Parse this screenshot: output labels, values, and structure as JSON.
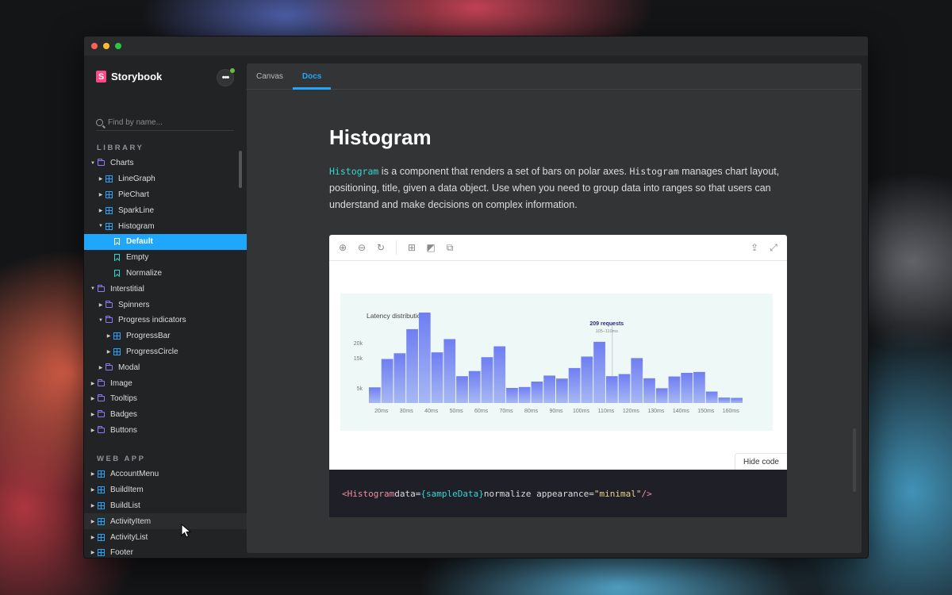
{
  "sidebar": {
    "brand": "Storybook",
    "menu_label": "•••",
    "search_placeholder": "Find by name...",
    "library_title": "LIBRARY",
    "webapp_title": "WEB APP",
    "library": [
      {
        "label": "Charts",
        "type": "folder",
        "depth": 0,
        "caret": "▼"
      },
      {
        "label": "LineGraph",
        "type": "component",
        "depth": 1,
        "caret": "▶"
      },
      {
        "label": "PieChart",
        "type": "component",
        "depth": 1,
        "caret": "▶"
      },
      {
        "label": "SparkLine",
        "type": "component",
        "depth": 1,
        "caret": "▶"
      },
      {
        "label": "Histogram",
        "type": "component",
        "depth": 1,
        "caret": "▼"
      },
      {
        "label": "Default",
        "type": "story",
        "depth": 2,
        "caret": "",
        "selected": true
      },
      {
        "label": "Empty",
        "type": "story",
        "depth": 2,
        "caret": ""
      },
      {
        "label": "Normalize",
        "type": "story",
        "depth": 2,
        "caret": ""
      },
      {
        "label": "Interstitial",
        "type": "folder",
        "depth": 0,
        "caret": "▼"
      },
      {
        "label": "Spinners",
        "type": "folder",
        "depth": 1,
        "caret": "▶"
      },
      {
        "label": "Progress indicators",
        "type": "folder",
        "depth": 1,
        "caret": "▼"
      },
      {
        "label": "ProgressBar",
        "type": "component",
        "depth": 2,
        "caret": "▶"
      },
      {
        "label": "ProgressCircle",
        "type": "component",
        "depth": 2,
        "caret": "▶"
      },
      {
        "label": "Modal",
        "type": "folder",
        "depth": 1,
        "caret": "▶"
      },
      {
        "label": "Image",
        "type": "folder",
        "depth": 0,
        "caret": "▶"
      },
      {
        "label": "Tooltips",
        "type": "folder",
        "depth": 0,
        "caret": "▶"
      },
      {
        "label": "Badges",
        "type": "folder",
        "depth": 0,
        "caret": "▶"
      },
      {
        "label": "Buttons",
        "type": "folder",
        "depth": 0,
        "caret": "▶"
      }
    ],
    "webapp": [
      {
        "label": "AccountMenu",
        "type": "component",
        "depth": 0,
        "caret": "▶"
      },
      {
        "label": "BuildItem",
        "type": "component",
        "depth": 0,
        "caret": "▶"
      },
      {
        "label": "BuildList",
        "type": "component",
        "depth": 0,
        "caret": "▶"
      },
      {
        "label": "ActivityItem",
        "type": "component",
        "depth": 0,
        "caret": "▶",
        "hover": true
      },
      {
        "label": "ActivityList",
        "type": "component",
        "depth": 0,
        "caret": "▶"
      },
      {
        "label": "Footer",
        "type": "component",
        "depth": 0,
        "caret": "▶"
      },
      {
        "label": "Header",
        "type": "component",
        "depth": 0,
        "caret": "▶"
      }
    ]
  },
  "tabs": [
    {
      "label": "Canvas",
      "active": false
    },
    {
      "label": "Docs",
      "active": true
    }
  ],
  "doc": {
    "title": "Histogram",
    "desc_code_1": "Histogram",
    "desc_text_1": " is a component that renders a set of bars on polar axes. ",
    "desc_code_2": "Histogram",
    "desc_text_2": " manages chart layout, positioning, title, given a data object. Use when you need to group data into ranges so that users can understand and make decisions on complex information."
  },
  "preview_toolbar": {
    "zoom_in": "⊕",
    "zoom_out": "⊖",
    "reset": "↻",
    "grid": "⊞",
    "background": "◩",
    "outline": "⧉",
    "share": "⇪",
    "fullscreen": "⤢"
  },
  "hide_code_label": "Hide code",
  "code": {
    "tag_open": "<Histogram",
    "attr1": " data=",
    "brace_value": "{sampleData}",
    "attr2": " normalize appearance=",
    "str_value": "\"minimal\"",
    "tag_close": " />"
  },
  "colors": {
    "accent": "#1ea7fd",
    "brand": "#ff4785",
    "bar_top": "#6f7ef2",
    "bar_bottom": "#a7b8f3"
  },
  "chart_data": {
    "type": "bar",
    "title": "Latency distribution",
    "xlabel": "",
    "ylabel": "",
    "ylim": [
      0,
      25000
    ],
    "yticks": [
      5000,
      15000,
      20000
    ],
    "ytick_labels": [
      "5k",
      "15k",
      "20k"
    ],
    "xtick_labels": [
      "20ms",
      "30ms",
      "40ms",
      "50ms",
      "60ms",
      "70ms",
      "80ms",
      "90ms",
      "100ms",
      "110ms",
      "120ms",
      "130ms",
      "140ms",
      "150ms",
      "160ms"
    ],
    "values": [
      5200,
      14600,
      16500,
      24500,
      30000,
      16800,
      21200,
      8900,
      10600,
      15200,
      18800,
      5000,
      5300,
      7100,
      9100,
      8100,
      11600,
      15400,
      20300,
      8900,
      9600,
      14900,
      8200,
      4900,
      8800,
      10000,
      10300,
      3800,
      1800,
      1700
    ],
    "annotation": {
      "label": "209 requests",
      "sublabel": "105–110ms",
      "bar_index": 19
    }
  }
}
